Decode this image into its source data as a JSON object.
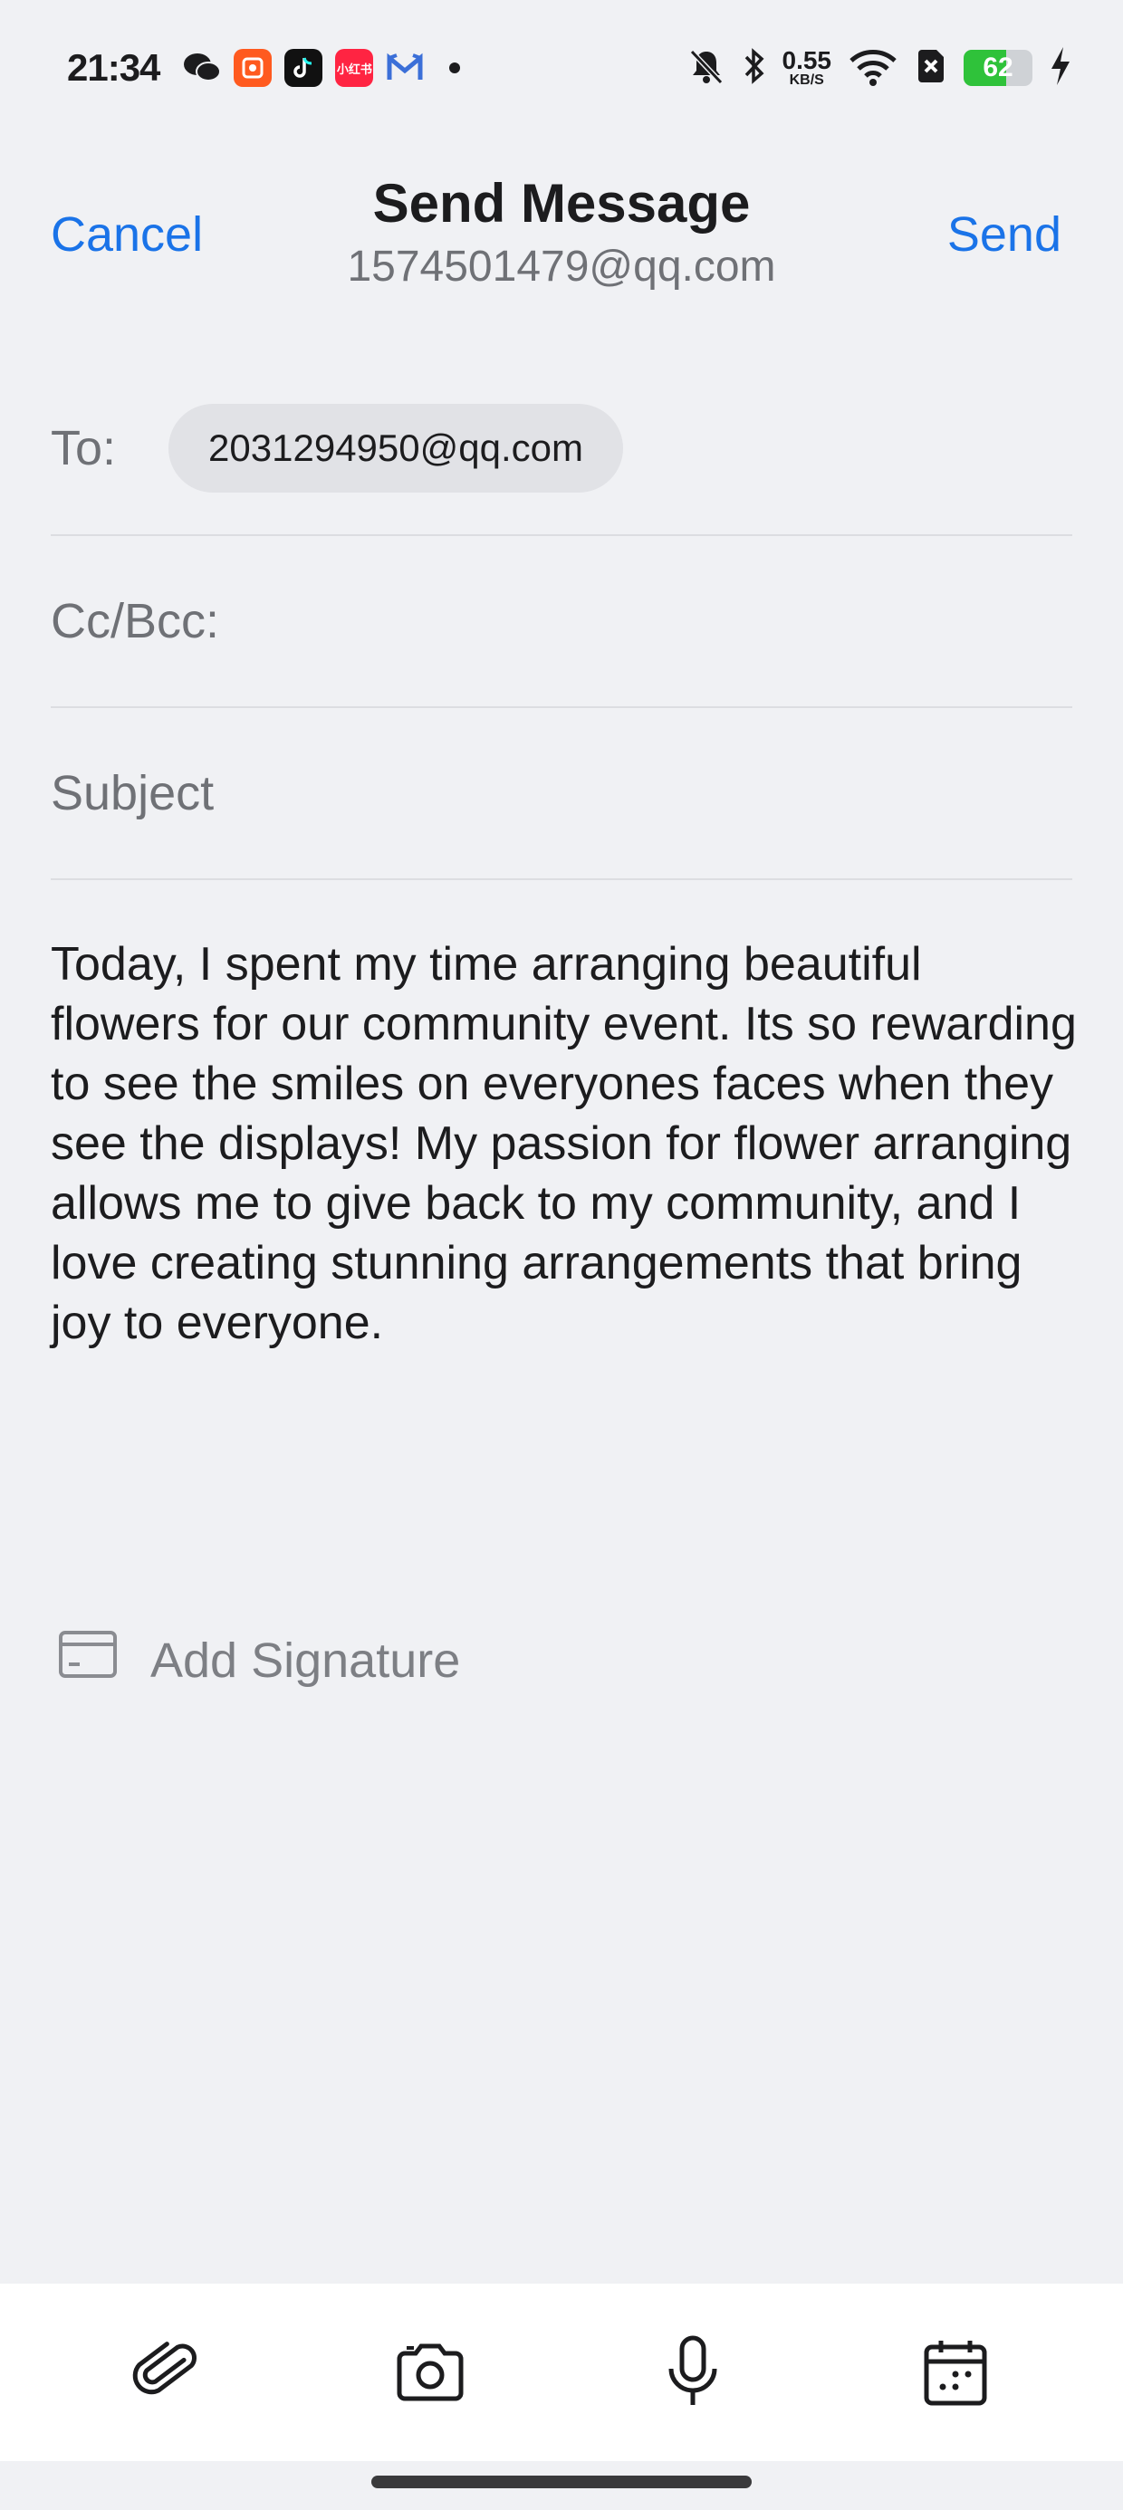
{
  "status_bar": {
    "time": "21:34",
    "apps": [
      {
        "name": "wechat-icon",
        "color": "#1c1c1e"
      },
      {
        "name": "taobao-icon",
        "color": "#ff5a1f"
      },
      {
        "name": "tiktok-icon",
        "color": "#111111"
      },
      {
        "name": "xiaohongshu-icon",
        "color": "#ff2442",
        "text": "小红书"
      },
      {
        "name": "mail-app-icon",
        "color": "#3b6fd8"
      }
    ],
    "net_speed_value": "0.55",
    "net_speed_unit": "KB/S",
    "battery_level": "62"
  },
  "header": {
    "cancel_label": "Cancel",
    "title": "Send Message",
    "from_address": "1574501479@qq.com",
    "send_label": "Send"
  },
  "fields": {
    "to_label": "To:",
    "to_recipient": "2031294950@qq.com",
    "cc_label": "Cc/Bcc:",
    "subject_placeholder": "Subject"
  },
  "body": {
    "text": "Today, I spent my time arranging beautiful flowers for our community event. Its so rewarding to see the smiles on everyones faces when they see the displays! My passion for flower arranging allows me to give back to my community, and I love creating stunning arrangements that bring joy to everyone."
  },
  "signature": {
    "label": "Add Signature"
  },
  "toolbar": {
    "items": [
      "attach-icon",
      "camera-icon",
      "microphone-icon",
      "calendar-icon"
    ]
  },
  "colors": {
    "accent": "#1a73e8",
    "background": "#f0f1f4",
    "battery_fill": "#2fc23a"
  }
}
